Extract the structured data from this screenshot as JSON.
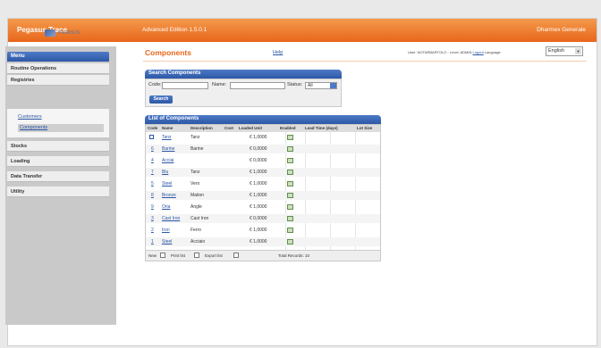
{
  "app": {
    "title": "Pegasus Trace",
    "edition": "Advanced Edition 1.5.0.1",
    "company": "Dharmex Generale"
  },
  "sidebar": {
    "logo_text": "PEGASUS",
    "menu_header": "Menu",
    "items": [
      {
        "label": "Routine Operations"
      },
      {
        "label": "Registries"
      },
      {
        "label": "Stocks"
      },
      {
        "label": "Loading"
      },
      {
        "label": "Data Transfer"
      },
      {
        "label": "Utility"
      }
    ],
    "sub_items": [
      {
        "label": "Customers"
      },
      {
        "label": "Components"
      }
    ]
  },
  "header": {
    "page_title": "Components",
    "help_link": "Help",
    "user_text": "User: NOTARBARTOLO - Level: ADMIN",
    "logout": "Logout",
    "language_label": "Language",
    "language_value": "English"
  },
  "search": {
    "title": "Search Components",
    "code_label": "Code:",
    "name_label": "Name:",
    "status_label": "Status:",
    "status_value": "All",
    "search_button": "Search"
  },
  "list": {
    "title": "List of Components",
    "columns": [
      "Code",
      "Name",
      "Description",
      "Cost",
      "Loaded Unit",
      "Enabled",
      "Lead Time (days)",
      "Lot Size"
    ],
    "rows": [
      {
        "code": "10",
        "name": "Tanz",
        "description": "Tanz",
        "cost": "€ 1,0000"
      },
      {
        "code": "6",
        "name": "Barine",
        "description": "Barine",
        "cost": "€ 0,0000"
      },
      {
        "code": "4",
        "name": "Acciai",
        "description": "",
        "cost": "€ 0,0000"
      },
      {
        "code": "7",
        "name": "Blu",
        "description": "Tanz",
        "cost": "€ 1,0000"
      },
      {
        "code": "5",
        "name": "Steel",
        "description": "Vero",
        "cost": "€ 1,0000"
      },
      {
        "code": "8",
        "name": "Bronze",
        "description": "Mation",
        "cost": "€ 1,0000"
      },
      {
        "code": "9",
        "name": "Oria",
        "description": "Angle",
        "cost": "€ 1,0000"
      },
      {
        "code": "3",
        "name": "Cast Iron",
        "description": "Cast Iron",
        "cost": "€ 0,0000"
      },
      {
        "code": "2",
        "name": "Iron",
        "description": "Ferro",
        "cost": "€ 1,0000"
      },
      {
        "code": "1",
        "name": "Steel",
        "description": "Acciaio",
        "cost": "€ 1,0000"
      }
    ],
    "footer_new": "New",
    "footer_print": "Print list",
    "footer_export": "Export list",
    "total_records": "Total Records: 10"
  }
}
